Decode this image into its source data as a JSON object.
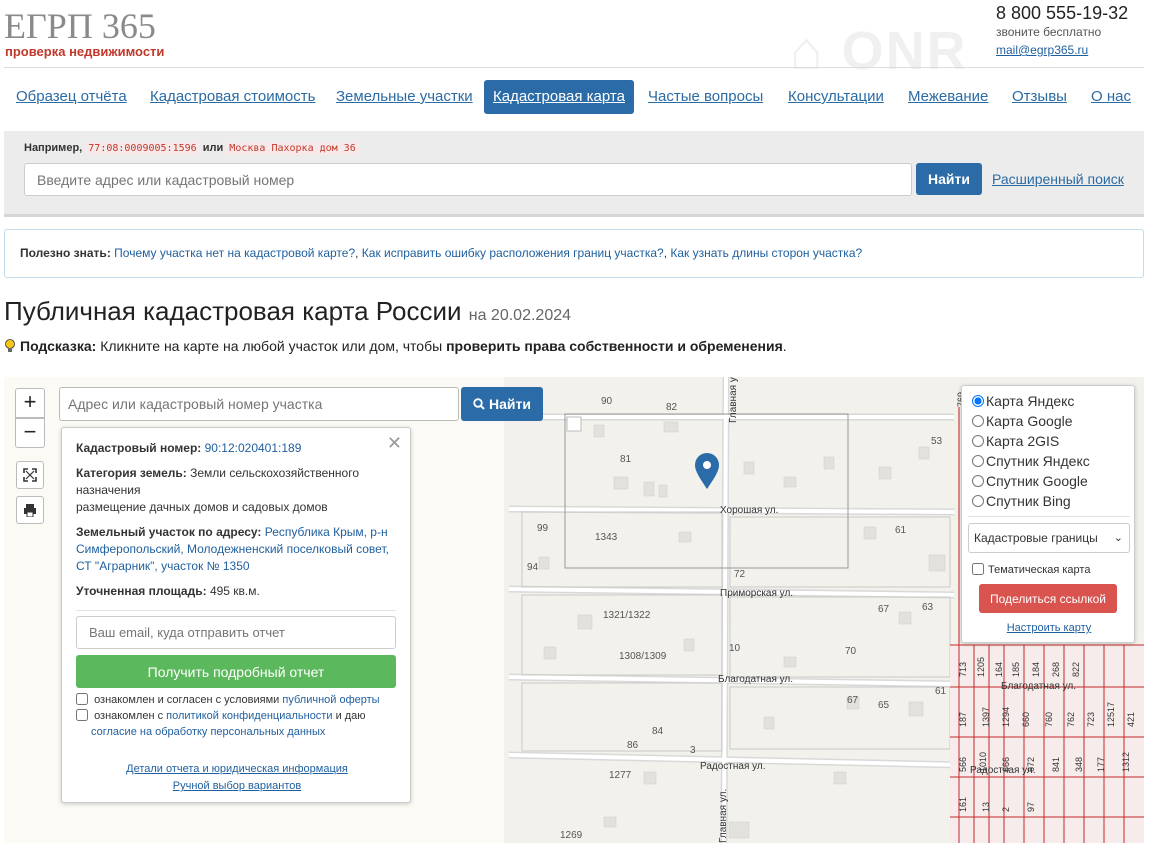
{
  "header": {
    "logo": "ЕГРП 365",
    "logo_sub": "проверка недвижимости",
    "phone": "8 800 555-19-32",
    "phone_sub": "звоните бесплатно",
    "email": "mail@egrp365.ru"
  },
  "nav": {
    "items": [
      {
        "label": "Образец отчёта"
      },
      {
        "label": "Кадастровая стоимость"
      },
      {
        "label": "Земельные участки"
      },
      {
        "label": "Кадастровая карта",
        "active": true
      },
      {
        "label": "Частые вопросы"
      },
      {
        "label": "Консультации"
      },
      {
        "label": "Межевание"
      },
      {
        "label": "Отзывы"
      },
      {
        "label": "О нас"
      }
    ]
  },
  "search": {
    "example_prefix": "Например,",
    "example_code": "77:08:0009005:1596",
    "example_or": "или",
    "example_address": "Москва Пахорка дом 36",
    "placeholder": "Введите адрес или кадастровый номер",
    "find_label": "Найти",
    "advanced_label": "Расширенный поиск"
  },
  "useful": {
    "prefix": "Полезно знать:",
    "links": [
      "Почему участка нет на кадастровой карте?",
      "Как исправить ошибку расположения границ участка?",
      "Как узнать длины сторон участка?"
    ]
  },
  "page": {
    "title": "Публичная кадастровая карта России",
    "date": "на 20.02.2024",
    "hint_label": "Подсказка:",
    "hint_text": "Кликните на карте на любой участок или дом, чтобы",
    "hint_bold": "проверить права собственности и обременения",
    "hint_end": "."
  },
  "map": {
    "zoom_in": "+",
    "zoom_out": "−",
    "search_placeholder": "Адрес или кадастровый номер участка",
    "find_label": "Найти",
    "streets": [
      "Хорошая ул.",
      "Приморская ул.",
      "Благодатная ул.",
      "Радостная ул.",
      "Главная ул.",
      "Главная у",
      "Благодатная ул.",
      "Радостная ул."
    ],
    "parcel_numbers": [
      "90",
      "82",
      "81",
      "53",
      "99",
      "1343",
      "61",
      "94",
      "72",
      "1321/1322",
      "67",
      "63",
      "10",
      "1308/1309",
      "70",
      "61",
      "67",
      "65",
      "84",
      "86",
      "3",
      "1277",
      "1269"
    ],
    "red_parcel_numbers": [
      "769",
      "713",
      "1205",
      "164",
      "185",
      "184",
      "268",
      "822",
      "187",
      "1397",
      "1294",
      "660",
      "760",
      "762",
      "723",
      "12517",
      "421",
      "566",
      "1010",
      "666",
      "672",
      "841",
      "348",
      "177",
      "1312",
      "161",
      "13",
      "2",
      "97"
    ]
  },
  "info_panel": {
    "close": "✕",
    "cadastral_label": "Кадастровый номер:",
    "cadastral_value": "90:12:020401:189",
    "category_label": "Категория земель:",
    "category_value_1": "Земли сельскохозяйственного назначения",
    "category_value_2": "размещение дачных домов и садовых домов",
    "address_label": "Земельный участок по адресу:",
    "address_value": "Республика Крым, р-н Симферопольский, Молодежненский поселковый совет, СТ \"Аграрник\", участок № 1350",
    "area_label": "Уточненная площадь:",
    "area_value": "495 кв.м.",
    "email_placeholder": "Ваш email, куда отправить отчет",
    "report_button": "Получить подробный отчет",
    "agree1_text": "ознакомлен и согласен с условиями",
    "agree1_link": "публичной оферты",
    "agree2_text": "ознакомлен с",
    "agree2_link": "политикой конфиденциальности",
    "agree2_and": "и даю",
    "agree2_link2": "согласие на обработку персональных данных",
    "details_link": "Детали отчета и юридическая информация",
    "manual_link": "Ручной выбор вариантов"
  },
  "layers": {
    "options": [
      "Карта Яндекс",
      "Карта Google",
      "Карта 2GIS",
      "Спутник Яндекс",
      "Спутник Google",
      "Спутник Bing"
    ],
    "selected": "Карта Яндекс",
    "select_value": "Кадастровые границы",
    "thematic_label": "Тематическая карта",
    "share_button": "Поделиться ссылкой",
    "setup_link": "Настроить карту"
  },
  "colors": {
    "accent": "#2b6ca8",
    "logo_red": "#c0392b",
    "green": "#5cb85c",
    "red_button": "#d9534f",
    "parcel_red": "#c62828"
  }
}
